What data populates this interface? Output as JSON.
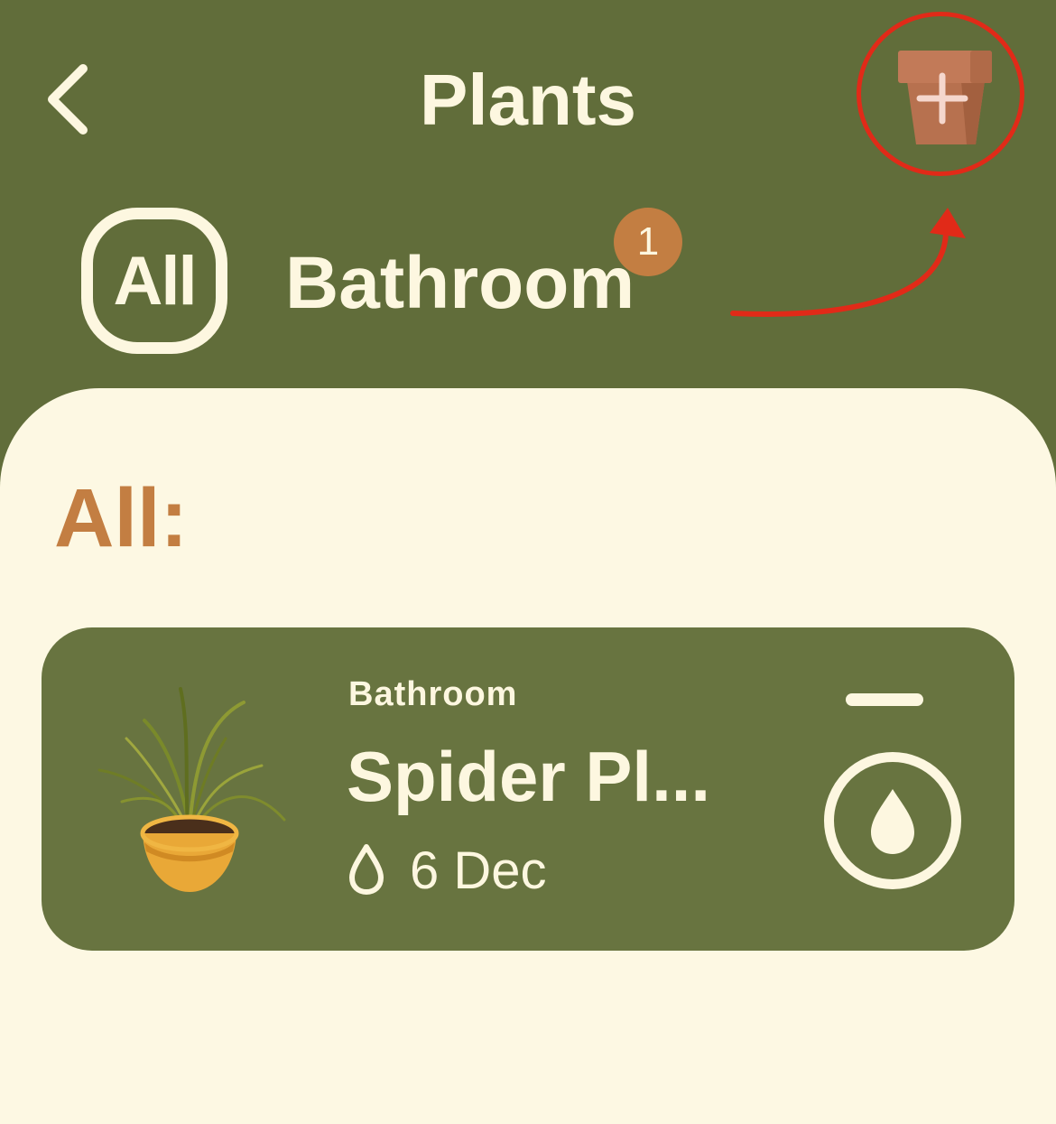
{
  "header": {
    "title": "Plants",
    "back_icon": "chevron-left-icon",
    "add_icon": "pot-plus-icon"
  },
  "filters": {
    "all_label": "All",
    "bathroom_label": "Bathroom",
    "bathroom_badge": "1"
  },
  "section": {
    "title": "All:"
  },
  "plant_card": {
    "room": "Bathroom",
    "name": "Spider Pl...",
    "next_watering": "6 Dec",
    "water_icon": "water-drop-icon"
  },
  "colors": {
    "header_bg": "#616d3a",
    "content_bg": "#fdf8e3",
    "card_bg": "#687440",
    "accent": "#c37e42",
    "highlight": "#e12a18"
  }
}
